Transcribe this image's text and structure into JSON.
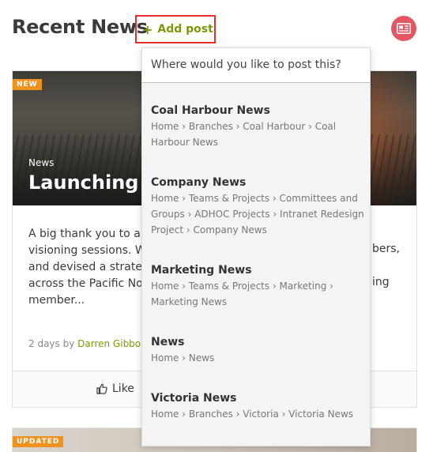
{
  "header": {
    "title": "Recent News",
    "add_post": {
      "icon": "plus-icon",
      "label": "Add post"
    },
    "news_icon": "newspaper-icon"
  },
  "card": {
    "badge": "NEW",
    "category": "News",
    "title": "Launching th",
    "body_lines": [
      "A big thank you to all e",
      "visioning sessions. We'",
      "and devised a strategi",
      "across the Pacific Nort",
      "member..."
    ],
    "body_right_fragments": [
      "bers,",
      "ing"
    ],
    "meta_prefix": "2 days by",
    "author": "Darren Gibbons",
    "like_label": "Like"
  },
  "card2": {
    "badge": "UPDATED"
  },
  "dropdown": {
    "header": "Where would you like to post this?",
    "items": [
      {
        "name": "Coal Harbour News",
        "path": "Home › Branches › Coal Harbour › Coal Harbour News"
      },
      {
        "name": "Company News",
        "path": "Home › Teams & Projects › Committees and Groups › ADHOC Projects › Intranet Redesign Project › Company News"
      },
      {
        "name": "Marketing News",
        "path": "Home › Teams & Projects › Marketing › Marketing News"
      },
      {
        "name": "News",
        "path": "Home › News"
      },
      {
        "name": "Victoria News",
        "path": "Home › Branches › Victoria › Victoria News"
      }
    ]
  },
  "colors": {
    "accent_green": "#7a9a0a",
    "highlight_red": "#e0302a",
    "badge_orange": "#f0921e",
    "news_icon_bg": "#e55665"
  }
}
